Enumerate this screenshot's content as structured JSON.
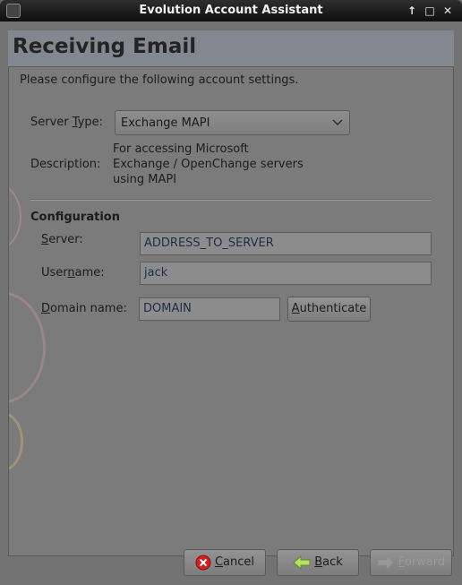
{
  "window": {
    "title": "Evolution Account Assistant",
    "controls": {
      "up": "↑",
      "maximize": "□",
      "close": "✕"
    }
  },
  "page": {
    "title": "Receiving Email",
    "intro": "Please configure the following account settings."
  },
  "server_type": {
    "label_pre": "Server ",
    "label_u": "T",
    "label_post": "ype:",
    "value": "Exchange MAPI"
  },
  "description": {
    "label": "Description:",
    "line1": "For accessing Microsoft",
    "line2": "Exchange / OpenChange servers",
    "line3": "using MAPI"
  },
  "configuration": {
    "heading": "Configuration",
    "server": {
      "label_u": "S",
      "label_post": "erver:",
      "value": "ADDRESS_TO_SERVER"
    },
    "username": {
      "label_pre": "User",
      "label_u": "n",
      "label_post": "ame:",
      "value": "jack"
    },
    "domain": {
      "label_u": "D",
      "label_post": "omain name:",
      "value": "DOMAIN"
    },
    "authenticate": {
      "label_u": "A",
      "label_post": "uthenticate"
    }
  },
  "buttons": {
    "cancel": {
      "label_u": "C",
      "label_post": "ancel"
    },
    "back": {
      "label_u": "B",
      "label_post": "ack"
    },
    "forward": {
      "label_u": "F",
      "label_post": "orward"
    }
  },
  "colors": {
    "cancel_icon": "#d02020",
    "back_icon": "#8bc34a",
    "deco": "#e0a0a0"
  }
}
